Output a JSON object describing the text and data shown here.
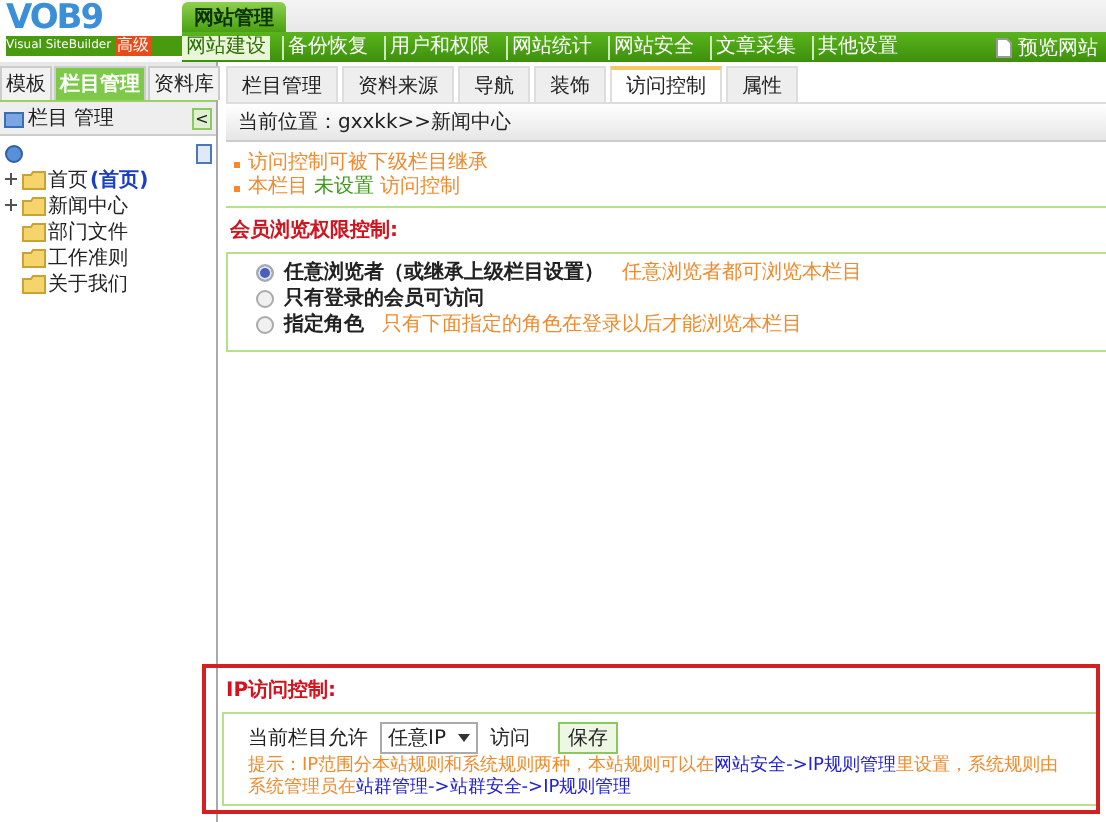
{
  "logo": {
    "name": "VOB9",
    "subtitle": "Visual SiteBuilder",
    "badge": "高级"
  },
  "main_tab": "网站管理",
  "top_menu": [
    {
      "label": "网站建设",
      "selected": true
    },
    {
      "label": "备份恢复",
      "selected": false
    },
    {
      "label": "用户和权限",
      "selected": false
    },
    {
      "label": "网站统计",
      "selected": false
    },
    {
      "label": "网站安全",
      "selected": false
    },
    {
      "label": "文章采集",
      "selected": false
    },
    {
      "label": "其他设置",
      "selected": false
    }
  ],
  "preview_link": "预览网站",
  "sidebar": {
    "tabs": [
      {
        "label": "模板",
        "selected": false
      },
      {
        "label": "栏目管理",
        "selected": true
      },
      {
        "label": "资料库",
        "selected": false
      }
    ],
    "header": "栏目 管理",
    "collapse": "<",
    "tree": {
      "children": [
        {
          "label": "首页",
          "extra": "(首页)",
          "expandable": true
        },
        {
          "label": "新闻中心",
          "expandable": true
        },
        {
          "label": "部门文件",
          "expandable": false
        },
        {
          "label": "工作准则",
          "expandable": false
        },
        {
          "label": "关于我们",
          "expandable": false
        }
      ]
    }
  },
  "content_tabs": [
    {
      "label": "栏目管理",
      "selected": false
    },
    {
      "label": "资料来源",
      "selected": false
    },
    {
      "label": "导航",
      "selected": false
    },
    {
      "label": "装饰",
      "selected": false
    },
    {
      "label": "访问控制",
      "selected": true
    },
    {
      "label": "属性",
      "selected": false
    }
  ],
  "breadcrumb": "当前位置：gxxkk>>新闻中心",
  "notes": [
    {
      "parts": [
        {
          "kind": "text",
          "text": "访问控制可被下级栏目继承"
        }
      ]
    },
    {
      "parts": [
        {
          "kind": "label",
          "text": "本栏目"
        },
        {
          "kind": "status",
          "text": "未设置"
        },
        {
          "kind": "text",
          "text": "访问控制"
        }
      ]
    }
  ],
  "member_section": {
    "title": "会员浏览权限控制:",
    "options": [
      {
        "label": "任意浏览者（或继承上级栏目设置）",
        "hint": "任意浏览者都可浏览本栏目",
        "selected": true
      },
      {
        "label": "只有登录的会员可访问",
        "selected": false
      },
      {
        "label": "指定角色",
        "hint": "只有下面指定的角色在登录以后才能浏览本栏目",
        "selected": false
      }
    ]
  },
  "ip_section": {
    "title": "IP访问控制:",
    "prefix": "当前栏目允许",
    "select_value": "任意IP",
    "suffix": "访问",
    "save_button": "保存",
    "hint": [
      {
        "kind": "text",
        "text": "提示：IP范围分本站规则和系统规则两种，本站规则可以在"
      },
      {
        "kind": "link",
        "text": "网站安全->IP规则管理"
      },
      {
        "kind": "text",
        "text": "里设置，系统规则由系统管理员在"
      },
      {
        "kind": "link",
        "text": "站群管理->站群安全->IP规则管理"
      }
    ]
  }
}
